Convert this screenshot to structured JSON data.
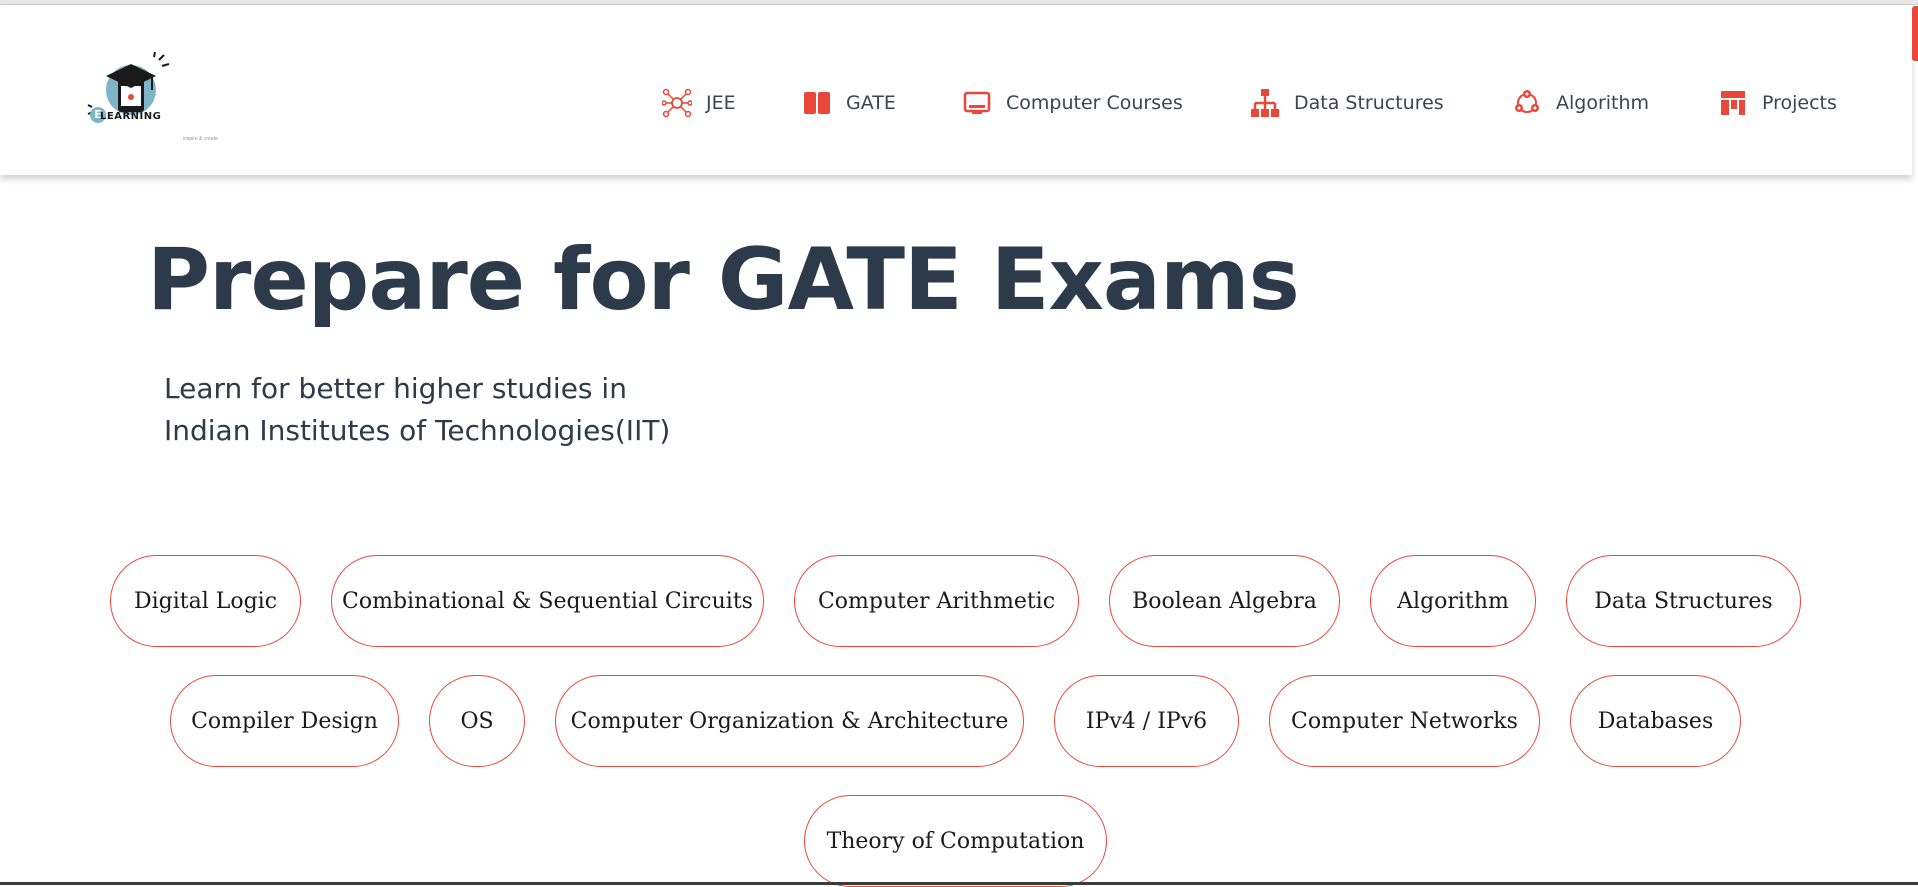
{
  "brand": {
    "logo_text": "LEARNING",
    "logo_letter": "E",
    "tagline": "inspire & create"
  },
  "colors": {
    "accent": "#e8473a",
    "heading": "#2c3a4a",
    "nav_text": "#3b4452"
  },
  "nav": [
    {
      "label": "JEE",
      "icon": "network-node-icon"
    },
    {
      "label": "GATE",
      "icon": "book-icon"
    },
    {
      "label": "Computer Courses",
      "icon": "laptop-icon"
    },
    {
      "label": "Data Structures",
      "icon": "hierarchy-icon"
    },
    {
      "label": "Algorithm",
      "icon": "cycle-icon"
    },
    {
      "label": "Projects",
      "icon": "layout-icon"
    }
  ],
  "hero": {
    "title": "Prepare for GATE Exams",
    "subtitle_line1": "Learn for better higher studies in",
    "subtitle_line2": "Indian Institutes of Technologies(IIT)"
  },
  "topics": [
    "Digital Logic",
    "Combinational & Sequential Circuits",
    "Computer Arithmetic",
    "Boolean Algebra",
    "Algorithm",
    "Data Structures",
    "Compiler Design",
    "OS",
    "Computer Organization & Architecture",
    "IPv4 / IPv6",
    "Computer Networks",
    "Databases",
    "Theory of Computation"
  ]
}
